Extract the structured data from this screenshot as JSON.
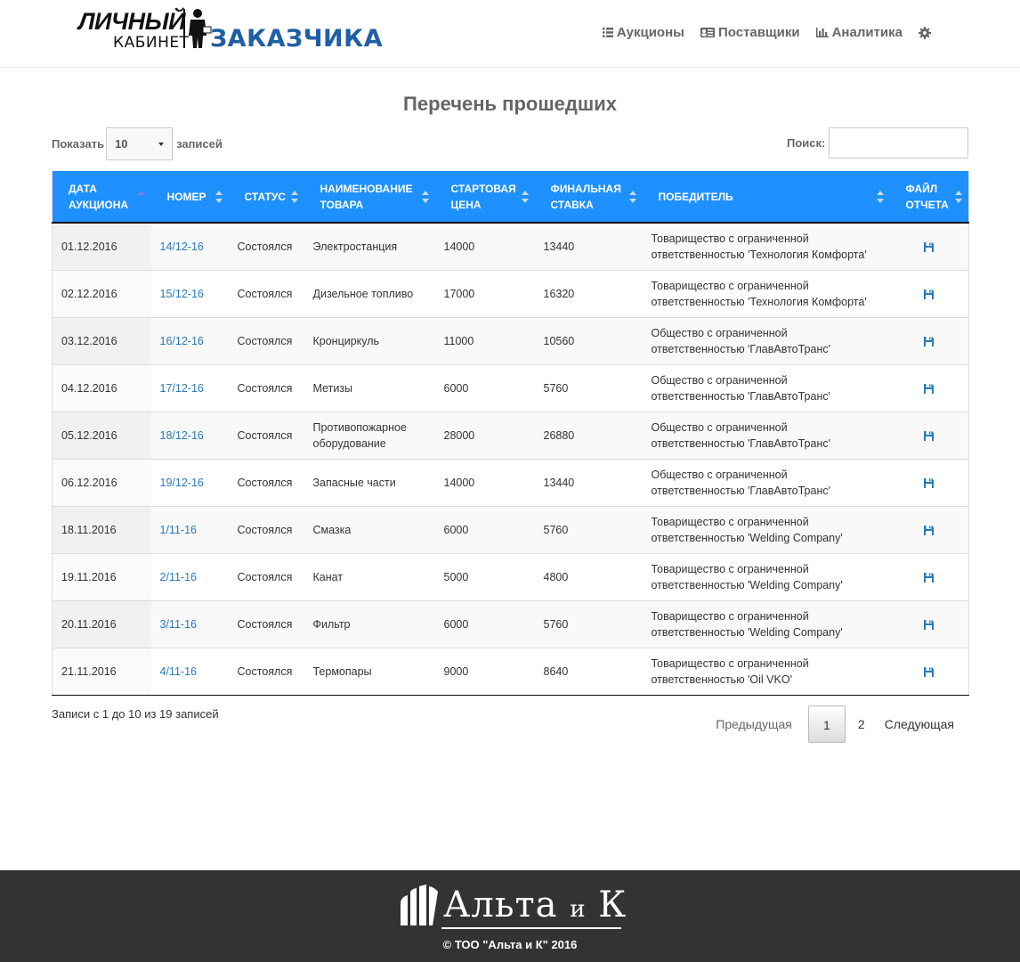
{
  "header": {
    "logo": {
      "line1": "ЛИЧНЫЙ",
      "line2": "КАБИНЕТ",
      "line3": "ЗАКАЗЧИКА"
    },
    "nav": [
      {
        "label": "Аукционы",
        "icon": "list-icon"
      },
      {
        "label": "Поставщики",
        "icon": "address-card-icon"
      },
      {
        "label": "Аналитика",
        "icon": "bar-chart-icon"
      }
    ],
    "settings_icon": "gear-icon"
  },
  "page": {
    "title": "Перечень прошедших"
  },
  "controls": {
    "show_label": "Показать",
    "page_size": "10",
    "records_label": "записей",
    "search_label": "Поиск:",
    "search_value": ""
  },
  "table": {
    "columns": [
      {
        "label": "ДАТА АУКЦИОНА",
        "sort": "asc"
      },
      {
        "label": "НОМЕР",
        "sort": "both"
      },
      {
        "label": "СТАТУС",
        "sort": "both"
      },
      {
        "label": "НАИМЕНОВАНИЕ ТОВАРА",
        "sort": "both"
      },
      {
        "label": "СТАРТОВАЯ ЦЕНА",
        "sort": "both"
      },
      {
        "label": "ФИНАЛЬНАЯ СТАВКА",
        "sort": "both"
      },
      {
        "label": "ПОБЕДИТЕЛЬ",
        "sort": "both"
      },
      {
        "label": "ФАЙЛ ОТЧЕТА",
        "sort": "both"
      }
    ],
    "rows": [
      {
        "date": "01.12.2016",
        "number": "14/12-16",
        "status": "Состоялся",
        "product": "Электростанция",
        "start_price": "14000",
        "final_bid": "13440",
        "winner": "Товарищество с ограниченной ответственностью 'Технология Комфорта'"
      },
      {
        "date": "02.12.2016",
        "number": "15/12-16",
        "status": "Состоялся",
        "product": "Дизельное топливо",
        "start_price": "17000",
        "final_bid": "16320",
        "winner": "Товарищество с ограниченной ответственностью 'Технология Комфорта'"
      },
      {
        "date": "03.12.2016",
        "number": "16/12-16",
        "status": "Состоялся",
        "product": "Кронциркуль",
        "start_price": "11000",
        "final_bid": "10560",
        "winner": "Общество с ограниченной ответственностью 'ГлавАвтоТранс'"
      },
      {
        "date": "04.12.2016",
        "number": "17/12-16",
        "status": "Состоялся",
        "product": "Метизы",
        "start_price": "6000",
        "final_bid": "5760",
        "winner": "Общество с ограниченной ответственностью 'ГлавАвтоТранс'"
      },
      {
        "date": "05.12.2016",
        "number": "18/12-16",
        "status": "Состоялся",
        "product": "Противопожарное оборудование",
        "start_price": "28000",
        "final_bid": "26880",
        "winner": "Общество с ограниченной ответственностью 'ГлавАвтоТранс'"
      },
      {
        "date": "06.12.2016",
        "number": "19/12-16",
        "status": "Состоялся",
        "product": "Запасные части",
        "start_price": "14000",
        "final_bid": "13440",
        "winner": "Общество с ограниченной ответственностью 'ГлавАвтоТранс'"
      },
      {
        "date": "18.11.2016",
        "number": "1/11-16",
        "status": "Состоялся",
        "product": "Смазка",
        "start_price": "6000",
        "final_bid": "5760",
        "winner": "Товарищество с ограниченной ответственностью 'Welding Company'"
      },
      {
        "date": "19.11.2016",
        "number": "2/11-16",
        "status": "Состоялся",
        "product": "Канат",
        "start_price": "5000",
        "final_bid": "4800",
        "winner": "Товарищество с ограниченной ответственностью 'Welding Company'"
      },
      {
        "date": "20.11.2016",
        "number": "3/11-16",
        "status": "Состоялся",
        "product": "Фильтр",
        "start_price": "6000",
        "final_bid": "5760",
        "winner": "Товарищество с ограниченной ответственностью 'Welding Company'"
      },
      {
        "date": "21.11.2016",
        "number": "4/11-16",
        "status": "Состоялся",
        "product": "Термопары",
        "start_price": "9000",
        "final_bid": "8640",
        "winner": "Товарищество с ограниченной ответственностью 'Oil VKO'"
      }
    ],
    "file_icon": "save-file-icon"
  },
  "info": "Записи с 1 до 10 из 19 записей",
  "pagination": {
    "prev": "Предыдущая",
    "pages": [
      "1",
      "2"
    ],
    "current": "1",
    "next": "Следующая"
  },
  "footer": {
    "logo_main": "Альта",
    "logo_small": "и",
    "logo_end": "К",
    "copyright": "© ТОО \"Альта и К\" 2016"
  },
  "colors": {
    "header_blue": "#1e90ff",
    "link": "#2a7ab8",
    "logo_blue": "#1e5fa5",
    "footer_bg": "#333333"
  }
}
